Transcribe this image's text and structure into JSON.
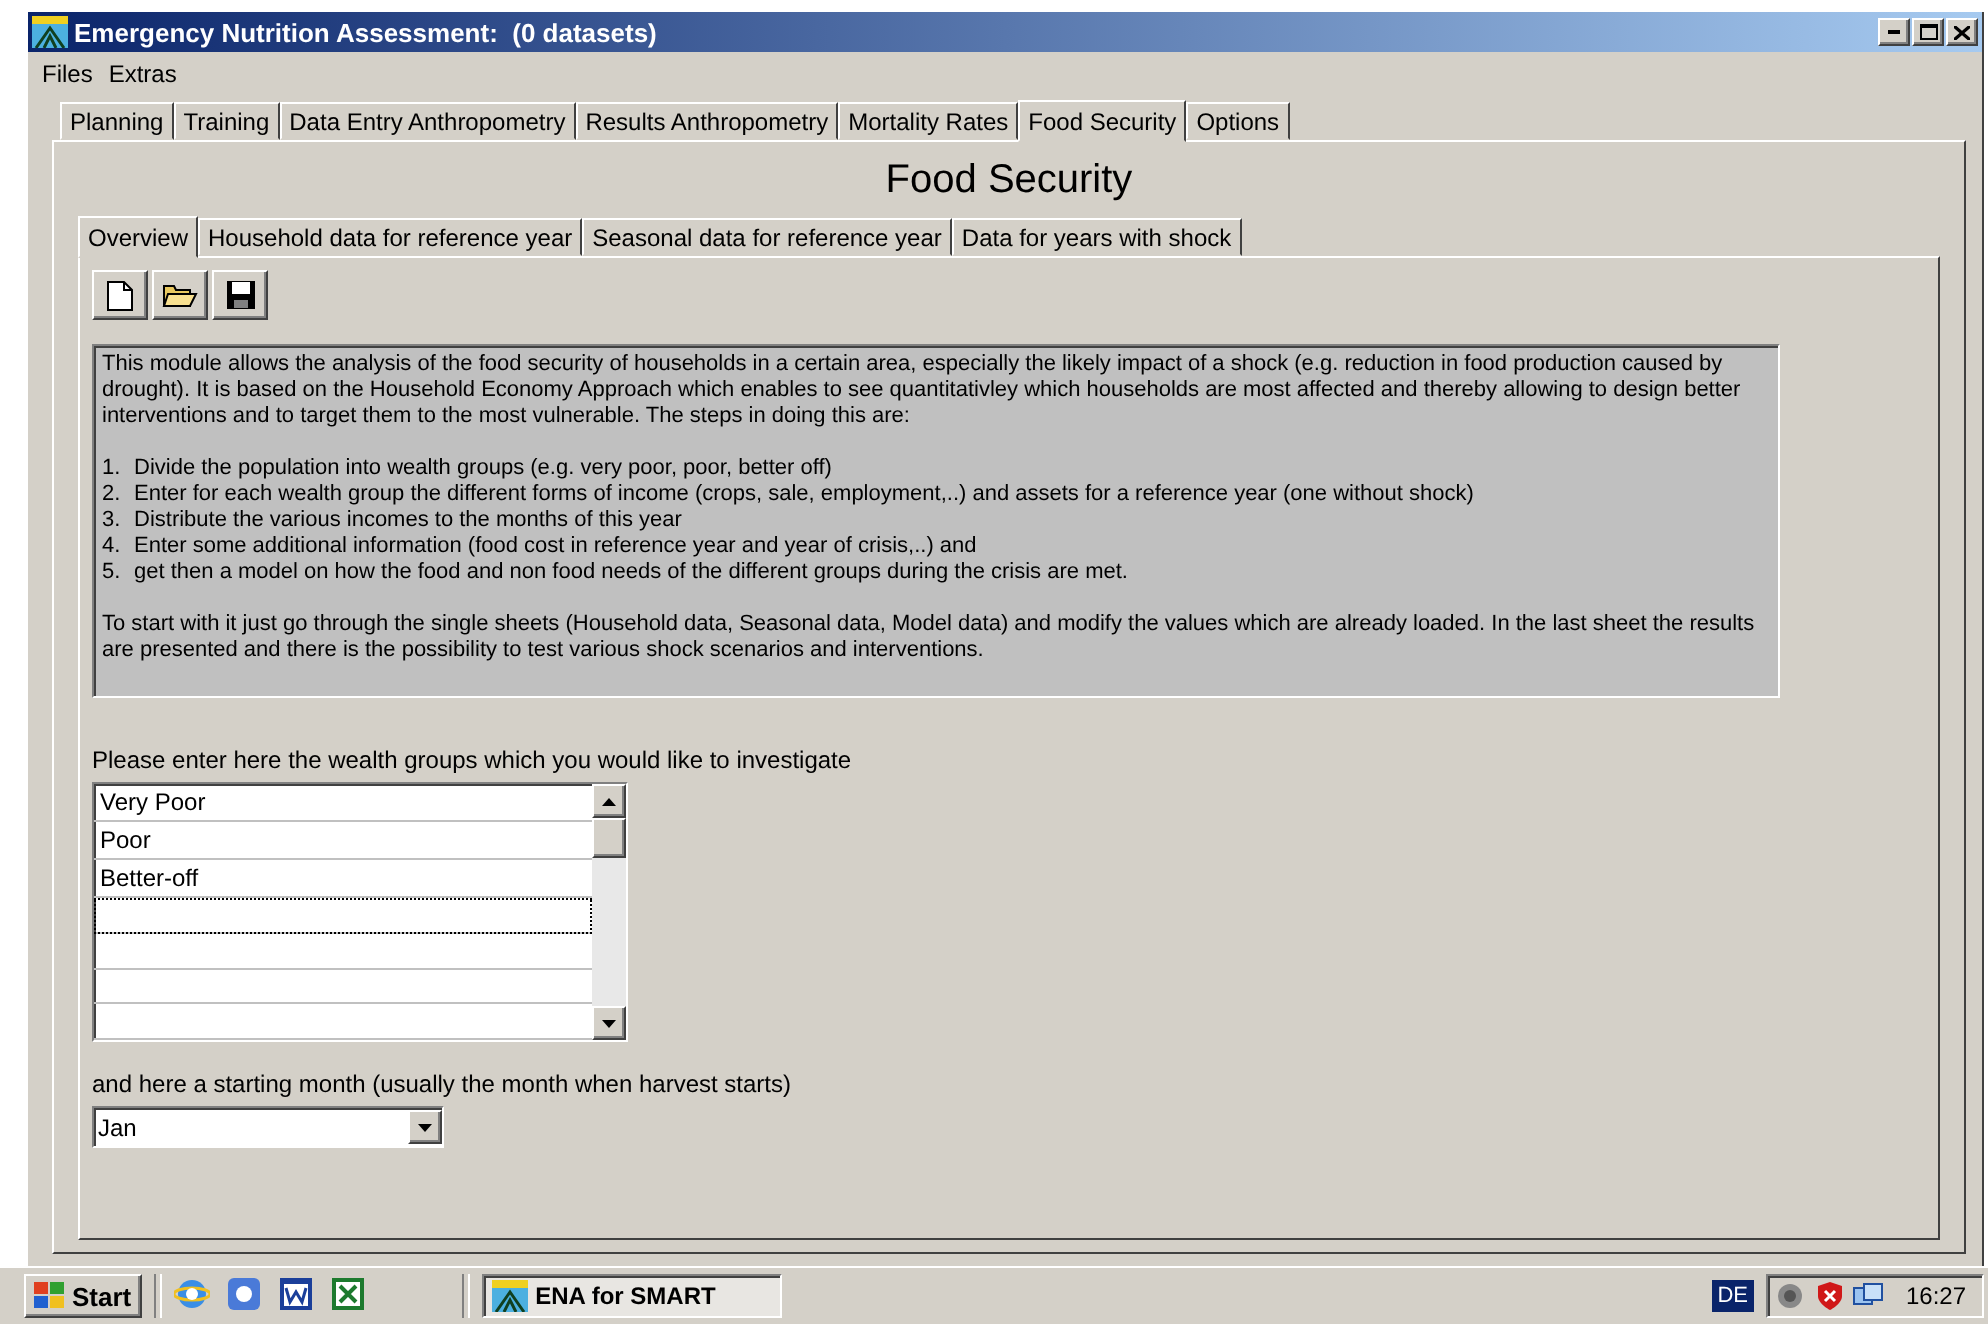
{
  "window": {
    "title": "Emergency Nutrition Assessment:  (0 datasets)"
  },
  "menu": [
    "Files",
    "Extras"
  ],
  "tabs": [
    {
      "label": "Planning",
      "selected": false
    },
    {
      "label": "Training",
      "selected": false
    },
    {
      "label": "Data Entry Anthropometry",
      "selected": false
    },
    {
      "label": "Results Anthropometry",
      "selected": false
    },
    {
      "label": "Mortality Rates",
      "selected": false
    },
    {
      "label": "Food Security",
      "selected": true
    },
    {
      "label": "Options",
      "selected": false
    }
  ],
  "page_title": "Food Security",
  "subtabs": [
    {
      "label": "Overview",
      "selected": true
    },
    {
      "label": "Household data for reference year",
      "selected": false
    },
    {
      "label": "Seasonal data for reference year",
      "selected": false
    },
    {
      "label": "Data for years with shock",
      "selected": false
    }
  ],
  "toolbar": [
    {
      "kind": "new"
    },
    {
      "kind": "open"
    },
    {
      "kind": "save"
    }
  ],
  "description": {
    "intro": "This module allows the analysis of the food security of households in a certain area, especially the likely impact of a shock (e.g. reduction in food production caused by drought). It is based on the Household Economy Approach which enables to see quantitativley which households are most affected and thereby allowing to design better interventions and to target them to the most vulnerable. The steps in doing this are:",
    "steps": [
      {
        "number": "1.",
        "text": "Divide the population into wealth groups (e.g. very poor, poor, better off)"
      },
      {
        "number": "2.",
        "text": "Enter for each wealth group the different forms of income (crops, sale, employment,..) and assets for a reference year (one without shock)"
      },
      {
        "number": "3.",
        "text": "Distribute the various incomes to the months of this year"
      },
      {
        "number": "4.",
        "text": "Enter some additional information (food cost in reference year and year of crisis,..) and"
      },
      {
        "number": "5.",
        "text": "get then a model on how the food and non food needs of the different groups during the crisis are met."
      }
    ],
    "outro": "To start with it just go through the single sheets (Household data, Seasonal data, Model data) and modify the values which are already loaded. In the last sheet the results are presented and there is the possibility to test various shock scenarios and interventions."
  },
  "wealth_groups": {
    "label": "Please enter here the wealth groups which you would like to investigate",
    "items": [
      "Very Poor",
      "Poor",
      "Better-off"
    ]
  },
  "month": {
    "label": "and here a starting month (usually the month when harvest starts)",
    "value": "Jan"
  },
  "taskbar": {
    "start": "Start",
    "quick_launch": [
      {
        "kind": "browser"
      },
      {
        "kind": "media"
      },
      {
        "kind": "word"
      },
      {
        "kind": "sheet"
      }
    ],
    "tasks": [
      {
        "label": "ENA for SMART",
        "selected": true
      }
    ],
    "language": "DE",
    "tray": [
      {
        "kind": "speaker"
      },
      {
        "kind": "shield"
      },
      {
        "kind": "network"
      }
    ],
    "clock": "16:27"
  }
}
